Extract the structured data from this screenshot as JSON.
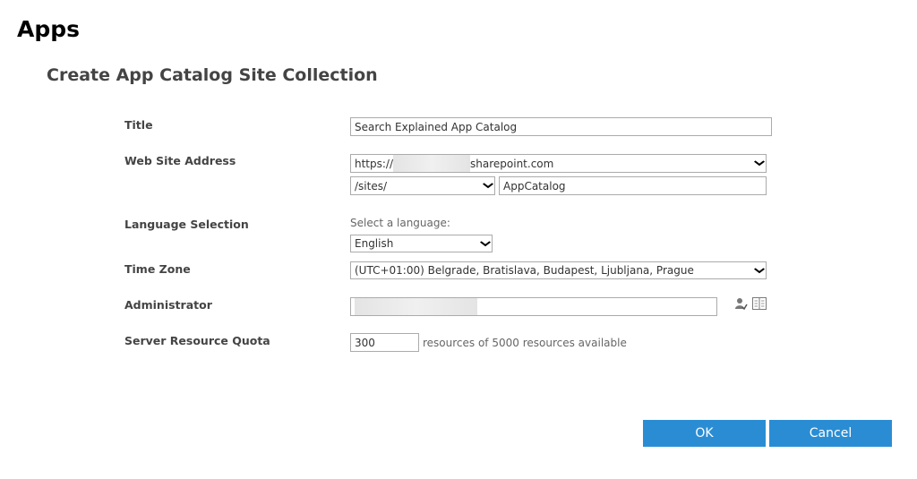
{
  "page": {
    "title": "Apps",
    "section_title": "Create App Catalog Site Collection"
  },
  "form": {
    "title": {
      "label": "Title",
      "value": "Search Explained App Catalog"
    },
    "web_site_address": {
      "label": "Web Site Address",
      "prefix": "https://",
      "domain": "sharepoint.com",
      "path_prefix": "/sites/",
      "url_name": "AppCatalog"
    },
    "language": {
      "label": "Language Selection",
      "hint": "Select a language:",
      "selected": "English"
    },
    "time_zone": {
      "label": "Time Zone",
      "selected": "(UTC+01:00) Belgrade, Bratislava, Budapest, Ljubljana, Prague"
    },
    "administrator": {
      "label": "Administrator",
      "check_icon": "check-names-icon",
      "browse_icon": "address-book-icon"
    },
    "quota": {
      "label": "Server Resource Quota",
      "value": "300",
      "suffix": "resources of 5000 resources available"
    }
  },
  "buttons": {
    "ok": "OK",
    "cancel": "Cancel"
  },
  "colors": {
    "primary": "#2a8dd4",
    "border": "#ababab"
  }
}
